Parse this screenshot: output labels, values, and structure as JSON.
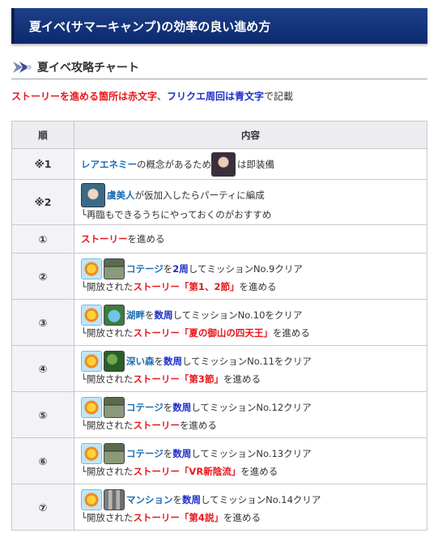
{
  "header": {
    "title": "夏イベ(サマーキャンプ)の効率の良い進め方"
  },
  "section": {
    "title": "夏イベ攻略チャート"
  },
  "intro": {
    "red_text": "ストーリーを進める箇所は赤文字",
    "separator": "、",
    "blue_text": "フリクエ周回は青文字",
    "suffix": "で記載"
  },
  "table": {
    "headers": [
      "順",
      "内容"
    ],
    "rows": [
      {
        "num": "※1",
        "l1a": "レアエネミー",
        "l1b": "の概念があるため",
        "l1c": "は即装備"
      },
      {
        "num": "※2",
        "l1a": "虞美人",
        "l1b": "が仮加入したらパーティに編成",
        "l2": "└再臨もできるうちにやっておくのがおすすめ"
      },
      {
        "num": "①",
        "l1a": "ストーリー",
        "l1b": "を進める"
      },
      {
        "num": "②",
        "loc": "コテージ",
        "mid": "を",
        "times": "2周",
        "rest": "してミッションNo.9クリア",
        "l2a": "└開放された",
        "l2b": "ストーリー「第1、2節」",
        "l2c": "を進める"
      },
      {
        "num": "③",
        "loc": "湖畔",
        "mid": "を",
        "times": "数周",
        "rest": "してミッションNo.10をクリア",
        "l2a": "└開放された",
        "l2b": "ストーリー「夏の御山の四天王」",
        "l2c": "を進める"
      },
      {
        "num": "④",
        "loc": "深い森",
        "mid": "を",
        "times": "数周",
        "rest": "してミッションNo.11をクリア",
        "l2a": "└開放された",
        "l2b": "ストーリー「第3節」",
        "l2c": "を進める"
      },
      {
        "num": "⑤",
        "loc": "コテージ",
        "mid": "を",
        "times": "数周",
        "rest": "してミッションNo.12クリア",
        "l2a": "└開放された",
        "l2b": "ストーリー",
        "l2c": "を進める"
      },
      {
        "num": "⑥",
        "loc": "コテージ",
        "mid": "を",
        "times": "数周",
        "rest": "してミッションNo.13クリア",
        "l2a": "└開放された",
        "l2b": "ストーリー「VR新陰流」",
        "l2c": "を進める"
      },
      {
        "num": "⑦",
        "loc": "マンション",
        "mid": "を",
        "times": "数周",
        "rest": "してミッションNo.14クリア",
        "l2a": "└開放された",
        "l2b": "ストーリー「第4説」",
        "l2c": "を進める"
      }
    ]
  },
  "colors": {
    "header_bg": "#0c2a6d",
    "story_red": "#e8161b",
    "quest_blue": "#1d2ec8",
    "link_blue": "#1f6eb3"
  }
}
